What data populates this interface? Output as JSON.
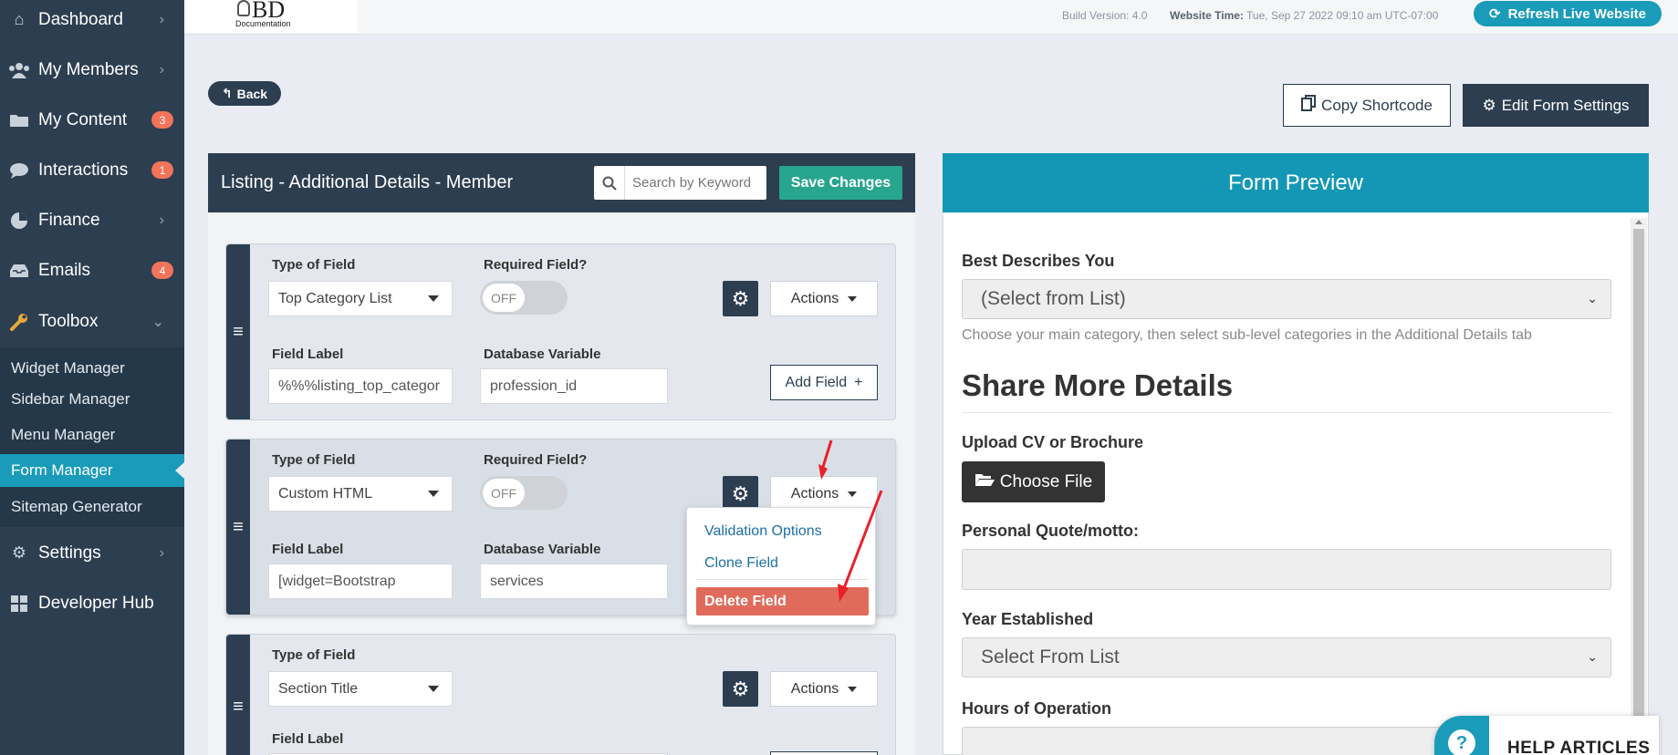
{
  "sidebar": {
    "items": [
      {
        "label": "Dashboard",
        "icon": "home-icon",
        "chevron": true
      },
      {
        "label": "My Members",
        "icon": "users-icon",
        "chevron": true
      },
      {
        "label": "My Content",
        "icon": "folder-icon",
        "badge": "3"
      },
      {
        "label": "Interactions",
        "icon": "chat-icon",
        "badge": "1"
      },
      {
        "label": "Finance",
        "icon": "pie-chart-icon",
        "chevron": true
      },
      {
        "label": "Emails",
        "icon": "inbox-icon",
        "badge": "4"
      },
      {
        "label": "Toolbox",
        "icon": "wrench-icon",
        "chevron_down": true
      },
      {
        "label": "Settings",
        "icon": "gear-icon",
        "chevron": true
      },
      {
        "label": "Developer Hub",
        "icon": "grid-icon"
      }
    ],
    "toolbox_items": [
      "Widget Manager",
      "Sidebar Manager",
      "Menu Manager",
      "Form Manager",
      "Sitemap Generator"
    ],
    "active_sub": "Form Manager"
  },
  "topbar": {
    "logo_text": "BD",
    "logo_sub": "Documentation",
    "build": "Build Version: 4.0",
    "website_time_label": "Website Time:",
    "website_time_value": "Tue, Sep 27 2022 09:10 am UTC-07:00",
    "refresh_label": "Refresh Live Website"
  },
  "main": {
    "back_label": "Back",
    "copy_shortcode_label": "Copy Shortcode",
    "edit_form_settings_label": "Edit Form Settings"
  },
  "left_panel": {
    "title": "Listing - Additional Details - Member",
    "search_placeholder": "Search by Keyword",
    "save_label": "Save Changes",
    "labels": {
      "type_of_field": "Type of Field",
      "required_field": "Required Field?",
      "field_label": "Field Label",
      "database_variable": "Database Variable",
      "actions": "Actions",
      "add_field": "Add Field",
      "toggle_off": "OFF"
    },
    "fields": [
      {
        "type": "Top Category List",
        "label_value": "%%%listing_top_categor",
        "db_var": "profession_id"
      },
      {
        "type": "Custom HTML",
        "label_value": "[widget=Bootstrap",
        "db_var": "services"
      },
      {
        "type": "Section Title"
      }
    ],
    "dropdown": {
      "items": [
        "Validation Options",
        "Clone Field"
      ],
      "delete_label": "Delete Field"
    }
  },
  "preview": {
    "title": "Form Preview",
    "best_describes_label": "Best Describes You",
    "best_describes_value": "(Select from List)",
    "help_text": "Choose your main category, then select sub-level categories in the Additional Details tab",
    "section_title": "Share More Details",
    "upload_label": "Upload CV or Brochure",
    "choose_file_label": "Choose File",
    "quote_label": "Personal Quote/motto:",
    "year_label": "Year Established",
    "year_value": "Select From List",
    "hours_label": "Hours of Operation"
  },
  "help": {
    "label": "HELP ARTICLES",
    "icon": "?"
  },
  "colors": {
    "sidebar": "#2c3e50",
    "accent": "#1a9bb9",
    "save": "#27a58e",
    "danger": "#e06b5b",
    "arrow": "#e8202a"
  }
}
